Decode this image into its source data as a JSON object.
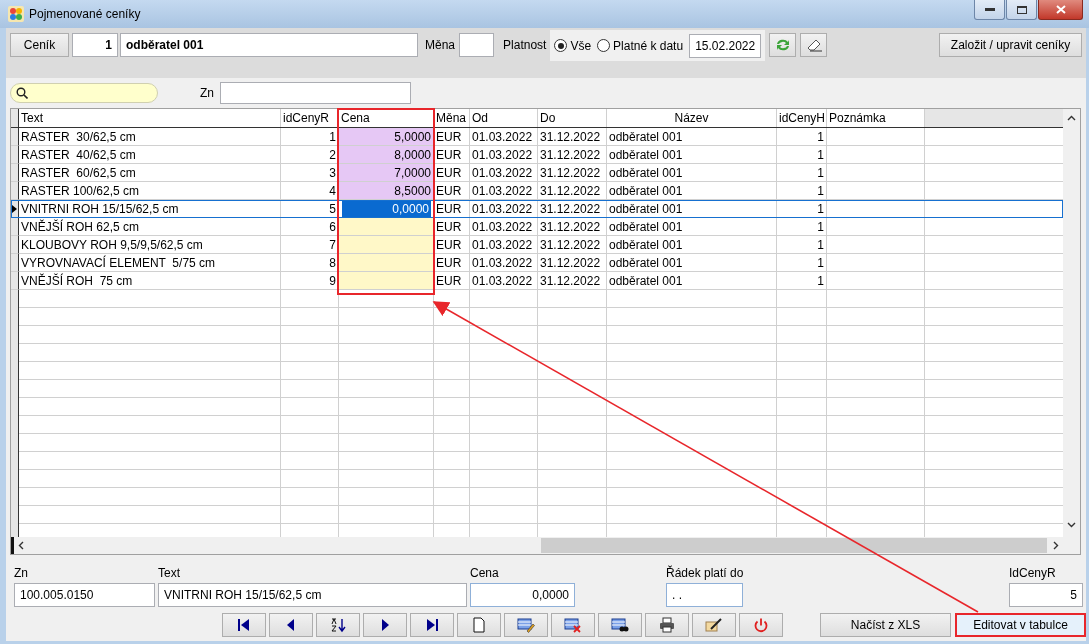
{
  "window": {
    "title": "Pojmenované ceníky"
  },
  "header": {
    "cenik_button": "Ceník",
    "cenik_number": "1",
    "cenik_name": "odběratel 001",
    "mena_label": "Měna",
    "platnost_label": "Platnost",
    "radios": [
      {
        "label": "Vše",
        "selected": true
      },
      {
        "label": "Platné k datu",
        "selected": false
      }
    ],
    "date": "15.02.2022",
    "create_button": "Založit / upravit ceníky"
  },
  "filter": {
    "zn_label": "Zn"
  },
  "table": {
    "columns": [
      "Text",
      "idCenyR",
      "Cena",
      "Měna",
      "Od",
      "Do",
      "Název",
      "idCenyH",
      "Poznámka"
    ],
    "rows": [
      {
        "text": "RASTER  30/62,5 cm",
        "id": "1",
        "cena": "5,0000",
        "mena": "EUR",
        "od": "01.03.2022",
        "do": "31.12.2022",
        "nazev": "odběratel 001",
        "idh": "1",
        "selected": false
      },
      {
        "text": "RASTER  40/62,5 cm",
        "id": "2",
        "cena": "8,0000",
        "mena": "EUR",
        "od": "01.03.2022",
        "do": "31.12.2022",
        "nazev": "odběratel 001",
        "idh": "1",
        "selected": false
      },
      {
        "text": "RASTER  60/62,5 cm",
        "id": "3",
        "cena": "7,0000",
        "mena": "EUR",
        "od": "01.03.2022",
        "do": "31.12.2022",
        "nazev": "odběratel 001",
        "idh": "1",
        "selected": false
      },
      {
        "text": "RASTER 100/62,5 cm",
        "id": "4",
        "cena": "8,5000",
        "mena": "EUR",
        "od": "01.03.2022",
        "do": "31.12.2022",
        "nazev": "odběratel 001",
        "idh": "1",
        "selected": false
      },
      {
        "text": "VNITRNI ROH 15/15/62,5 cm",
        "id": "5",
        "cena": "0,0000",
        "mena": "EUR",
        "od": "01.03.2022",
        "do": "31.12.2022",
        "nazev": "odběratel 001",
        "idh": "1",
        "selected": true
      },
      {
        "text": "VNĚJŠÍ ROH 62,5 cm",
        "id": "6",
        "mena": "EUR",
        "od": "01.03.2022",
        "do": "31.12.2022",
        "nazev": "odběratel 001",
        "idh": "1",
        "selected": false
      },
      {
        "text": "KLOUBOVY ROH 9,5/9,5/62,5 cm",
        "id": "7",
        "mena": "EUR",
        "od": "01.03.2022",
        "do": "31.12.2022",
        "nazev": "odběratel 001",
        "idh": "1",
        "selected": false
      },
      {
        "text": "VYROVNAVACÍ ELEMENT  5/75 cm",
        "id": "8",
        "mena": "EUR",
        "od": "01.03.2022",
        "do": "31.12.2022",
        "nazev": "odběratel 001",
        "idh": "1",
        "selected": false
      },
      {
        "text": "VNĚJŠÍ ROH  75 cm",
        "id": "9",
        "mena": "EUR",
        "od": "01.03.2022",
        "do": "31.12.2022",
        "nazev": "odběratel 001",
        "idh": "1",
        "selected": false
      }
    ]
  },
  "detail": {
    "zn": {
      "label": "Zn",
      "value": "100.005.0150"
    },
    "text": {
      "label": "Text",
      "value": "VNITRNI ROH 15/15/62,5 cm"
    },
    "cena": {
      "label": "Cena",
      "value": "0,0000"
    },
    "radek": {
      "label": "Řádek platí do",
      "value": ". ."
    },
    "idcenyr": {
      "label": "IdCenyR",
      "value": "5"
    }
  },
  "nav_buttons": [
    {
      "kind": "first"
    },
    {
      "kind": "prev"
    },
    {
      "kind": "sort"
    },
    {
      "kind": "next"
    },
    {
      "kind": "last"
    },
    {
      "kind": "new"
    },
    {
      "kind": "edit"
    },
    {
      "kind": "delete"
    },
    {
      "kind": "find"
    },
    {
      "kind": "print"
    },
    {
      "kind": "tools"
    },
    {
      "kind": "power"
    }
  ],
  "buttons": [
    {
      "label": "Načíst z XLS",
      "highlighted": false
    },
    {
      "label": "Editovat v tabulce",
      "highlighted": true
    }
  ]
}
